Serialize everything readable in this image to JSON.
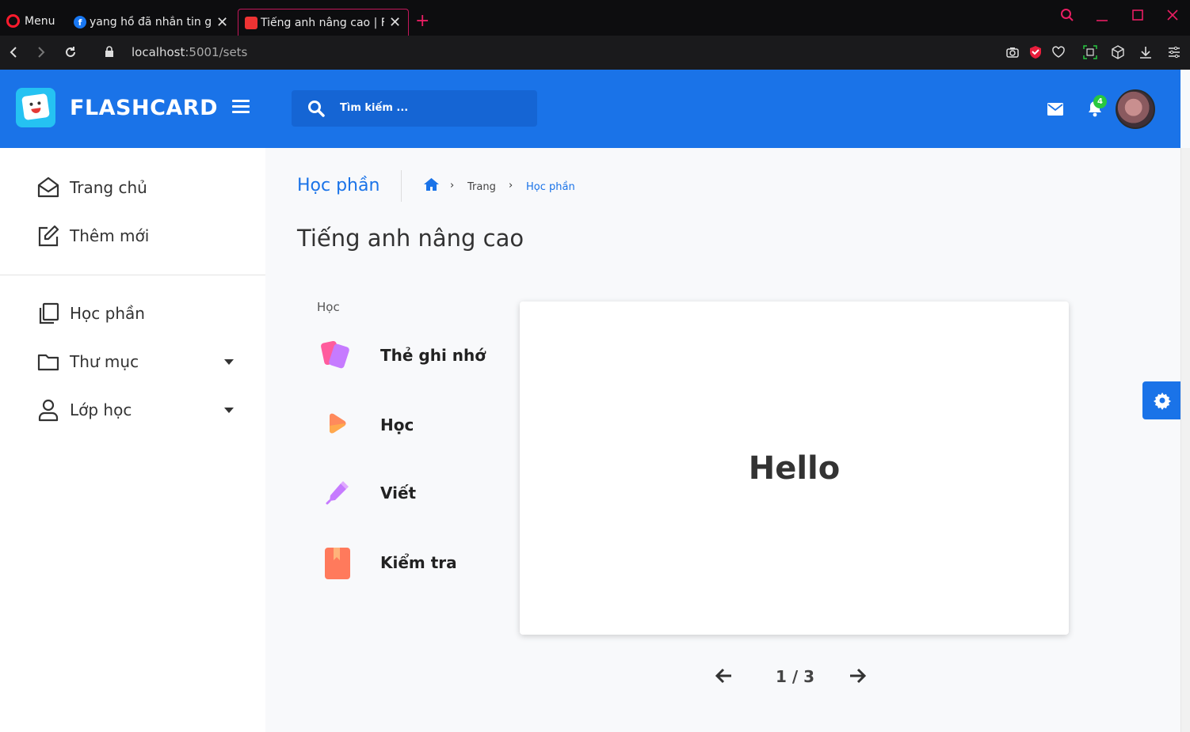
{
  "browser": {
    "menu_label": "Menu",
    "tabs": [
      {
        "title": "yang hồ đã nhắn tin gay",
        "icon": "facebook-icon"
      },
      {
        "title": "Tiếng anh nâng cao | Flas",
        "icon": "flashcard-favicon"
      }
    ],
    "url_host": "localhost",
    "url_path": ":5001/sets"
  },
  "header": {
    "brand": "FLASHCARD",
    "search_placeholder": "Tìm kiếm ...",
    "notification_count": "4",
    "accent_color": "#1a73e8"
  },
  "sidebar": {
    "top_items": [
      {
        "label": "Trang chủ",
        "icon": "home-icon"
      },
      {
        "label": "Thêm mới",
        "icon": "edit-icon"
      }
    ],
    "items": [
      {
        "label": "Học phần",
        "icon": "copy-icon"
      },
      {
        "label": "Thư mục",
        "icon": "folder-icon"
      },
      {
        "label": "Lớp học",
        "icon": "user-icon"
      }
    ]
  },
  "breadcrumb": {
    "title": "Học phần",
    "items": [
      "Trang",
      "Học phần"
    ]
  },
  "set": {
    "title": "Tiếng anh nâng cao",
    "study_heading": "Học",
    "modes": [
      {
        "label": "Thẻ ghi nhớ",
        "icon": "flashcards-icon"
      },
      {
        "label": "Học",
        "icon": "play-icon"
      },
      {
        "label": "Viết",
        "icon": "pen-icon"
      },
      {
        "label": "Kiểm tra",
        "icon": "book-icon"
      }
    ],
    "card_text": "Hello",
    "pager": "1 / 3"
  }
}
